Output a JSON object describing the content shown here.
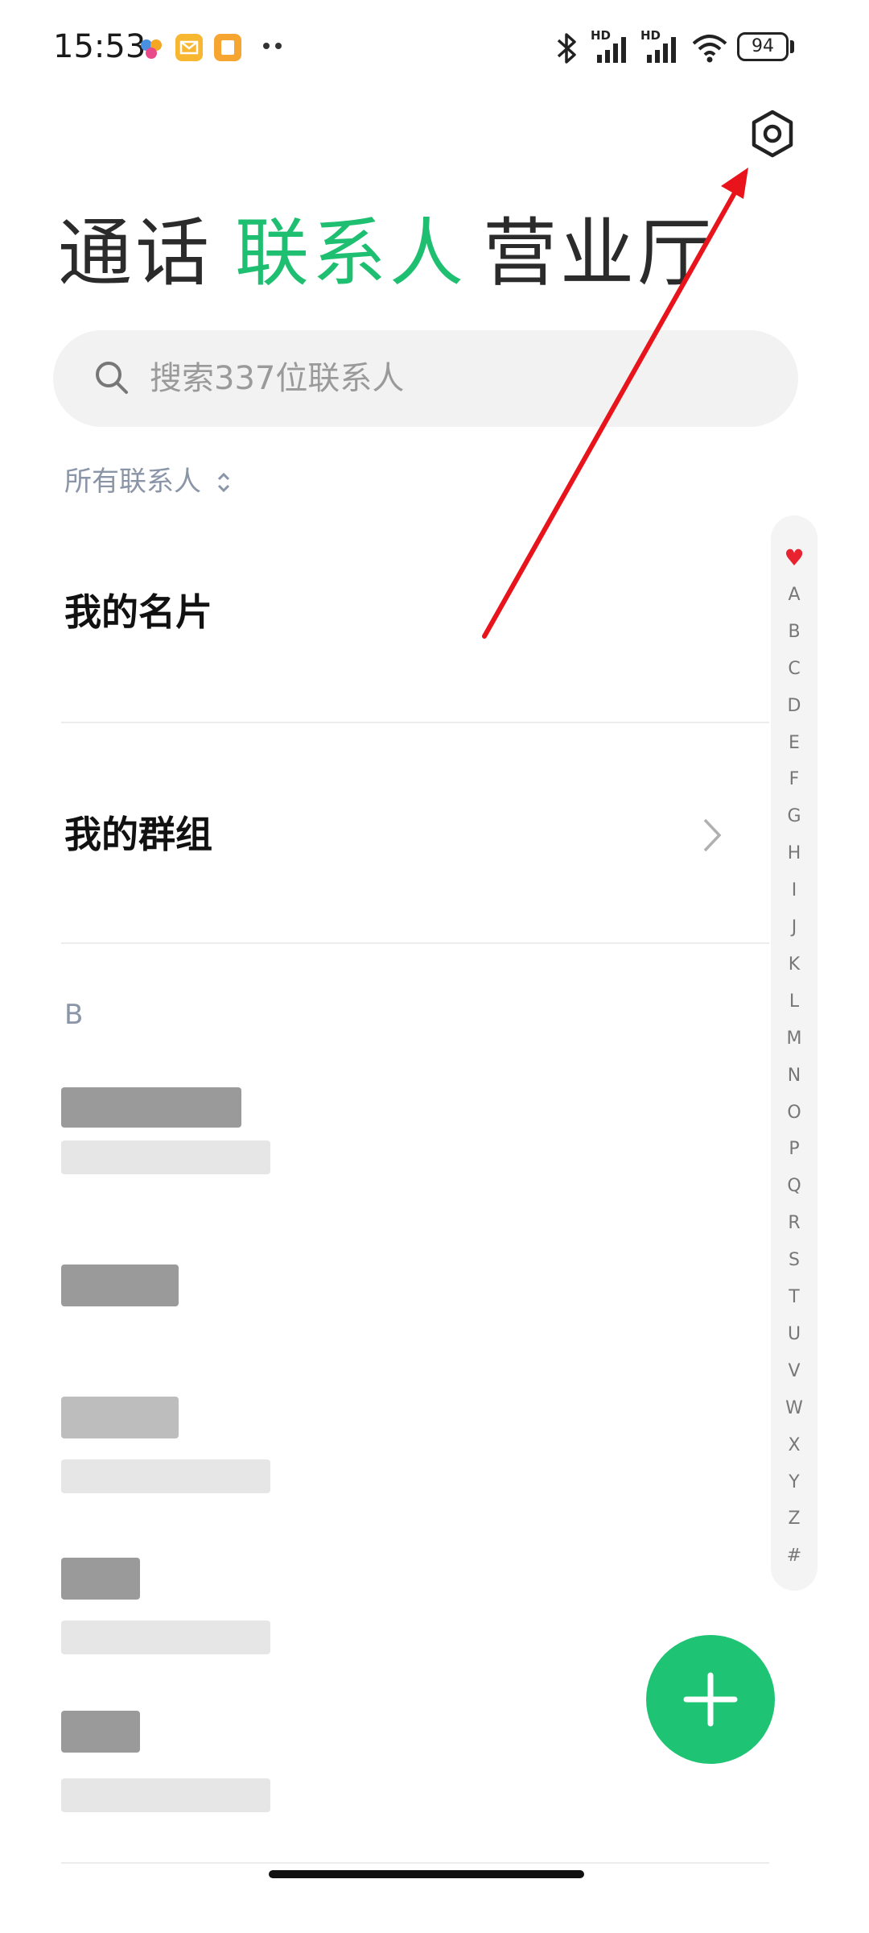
{
  "status_bar": {
    "time": "15:53",
    "battery": "94",
    "icons": [
      "colorful-app-icon",
      "mail-app-icon",
      "notes-app-icon",
      "more-dots-icon",
      "bluetooth-icon",
      "hd-signal-icon",
      "hd-signal-icon",
      "wifi-icon",
      "battery-icon"
    ],
    "signal_labels": [
      "HD",
      "HD"
    ]
  },
  "header": {
    "tabs": [
      {
        "label": "通话",
        "active": false
      },
      {
        "label": "联系人",
        "active": true
      },
      {
        "label": "营业厅",
        "active": false
      }
    ],
    "settings_icon": "hexagon-settings-icon"
  },
  "search": {
    "placeholder": "搜索337位联系人",
    "icon": "search-icon"
  },
  "filter": {
    "label": "所有联系人",
    "icon": "sort-toggle-icon"
  },
  "list": {
    "my_card": "我的名片",
    "my_groups": "我的群组",
    "section_letter": "B",
    "contacts_note": "blurred"
  },
  "index": {
    "letters": [
      "♥",
      "A",
      "B",
      "C",
      "D",
      "E",
      "F",
      "G",
      "H",
      "I",
      "J",
      "K",
      "L",
      "M",
      "N",
      "O",
      "P",
      "Q",
      "R",
      "S",
      "T",
      "U",
      "V",
      "W",
      "X",
      "Y",
      "Z",
      "#"
    ]
  },
  "fab": {
    "icon": "plus-icon"
  },
  "colors": {
    "accent": "#1fbf72",
    "fab": "#1ec473",
    "annotation_arrow": "#e8131b"
  }
}
